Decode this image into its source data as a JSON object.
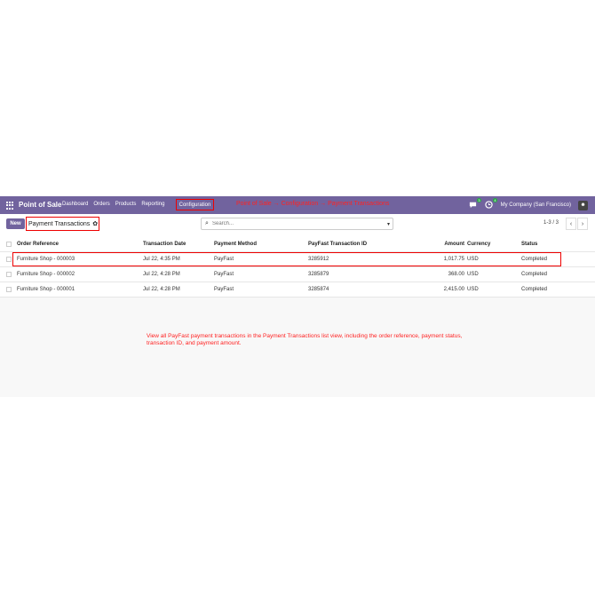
{
  "navbar": {
    "brand": "Point of Sale",
    "menu": [
      "Dashboard",
      "Orders",
      "Products",
      "Reporting"
    ],
    "active_menu": "Configuration",
    "annotation": "Point of Sale → Configuration → Payment Transactions",
    "chat_badge": "3",
    "activity_badge": "4",
    "company": "My Company (San Francisco)"
  },
  "control_panel": {
    "new_label": "New",
    "breadcrumb": "Payment Transactions",
    "search_placeholder": "Search...",
    "pager": "1-3 / 3"
  },
  "table": {
    "headers": {
      "order_reference": "Order Reference",
      "transaction_date": "Transaction Date",
      "payment_method": "Payment Method",
      "payfast_id": "PayFast Transaction ID",
      "amount": "Amount",
      "currency": "Currency",
      "status": "Status"
    },
    "rows": [
      {
        "order_reference": "Furniture Shop - 000003",
        "transaction_date": "Jul 22, 4:35 PM",
        "payment_method": "PayFast",
        "payfast_id": "3285912",
        "amount": "1,017.75",
        "currency": "USD",
        "status": "Completed"
      },
      {
        "order_reference": "Furniture Shop - 000002",
        "transaction_date": "Jul 22, 4:28 PM",
        "payment_method": "PayFast",
        "payfast_id": "3285879",
        "amount": "368.00",
        "currency": "USD",
        "status": "Completed"
      },
      {
        "order_reference": "Furniture Shop - 000001",
        "transaction_date": "Jul 22, 4:28 PM",
        "payment_method": "PayFast",
        "payfast_id": "3285874",
        "amount": "2,415.00",
        "currency": "USD",
        "status": "Completed"
      }
    ]
  },
  "description": "View all PayFast payment transactions in the Payment Transactions list view, including the order reference, payment status, transaction ID, and payment amount.",
  "colors": {
    "navbar": "#71639e",
    "annotation": "#ff2222",
    "highlight": "#e00000"
  }
}
